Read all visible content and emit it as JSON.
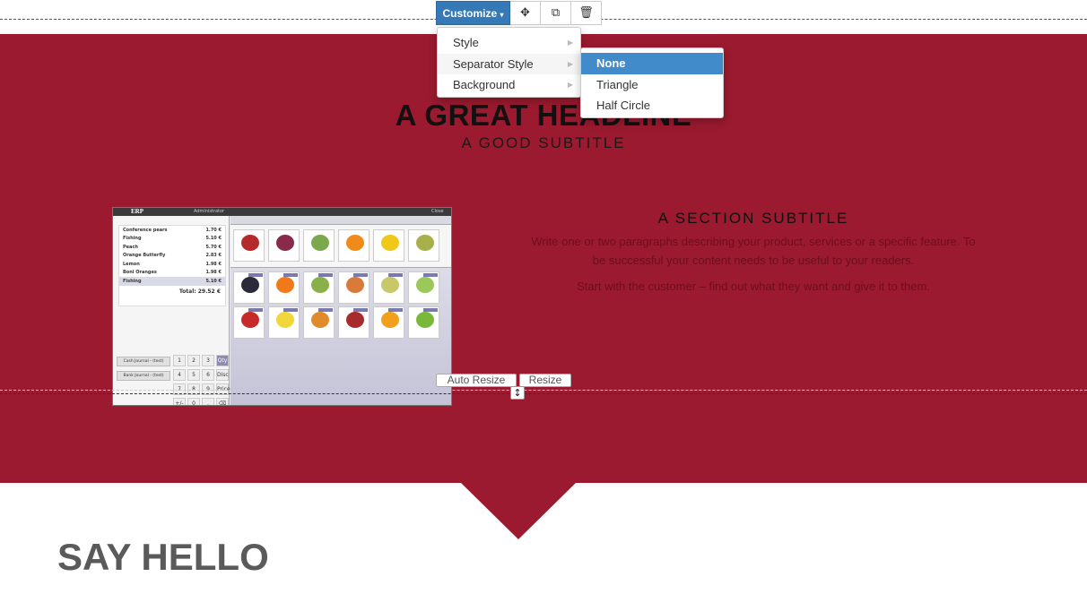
{
  "toolbar": {
    "customize_label": "Customize",
    "move_icon": "move-icon",
    "clone_icon": "clone-icon",
    "delete_icon": "trash-icon"
  },
  "customize_menu": {
    "items": [
      {
        "label": "Style"
      },
      {
        "label": "Separator Style"
      },
      {
        "label": "Background"
      }
    ]
  },
  "separator_submenu": {
    "items": [
      {
        "label": "None",
        "selected": true
      },
      {
        "label": "Triangle"
      },
      {
        "label": "Half Circle"
      }
    ]
  },
  "hero": {
    "headline": "A GREAT HEADLINE",
    "subtitle": "A GOOD SUBTITLE"
  },
  "feature": {
    "section_subtitle": "A SECTION SUBTITLE",
    "paragraph1": "Write one or two paragraphs describing your product, services or a specific feature. To be successful your content needs to be useful to your readers.",
    "paragraph2": "Start with the customer – find out what they want and give it to them."
  },
  "resize": {
    "auto_label": "Auto Resize",
    "resize_label": "Resize"
  },
  "pos": {
    "logo": "ERP",
    "user": "Administrator",
    "close": "Close",
    "orderlines": [
      {
        "name": "Conference pears",
        "price": "1.70 €"
      },
      {
        "name": "Fishing",
        "price": "5.10 €"
      },
      {
        "name": "Peach",
        "price": "5.70 €"
      },
      {
        "name": "Orange Butterfly",
        "price": "2.83 €"
      },
      {
        "name": "Lemon",
        "price": "1.98 €"
      },
      {
        "name": "Boni Oranges",
        "price": "1.98 €"
      },
      {
        "name": "Fishing",
        "price": "5.10 €"
      }
    ],
    "total": "Total: 29.52 €",
    "cash_journal": "Cash Journal - (test)",
    "bank_journal": "Bank Journal - (test)",
    "keys": [
      "1",
      "2",
      "3",
      "Qty",
      "4",
      "5",
      "6",
      "Disc",
      "7",
      "8",
      "9",
      "Price",
      "+/-",
      "0",
      ".",
      "⌫"
    ]
  },
  "footer": {
    "say_hello": "SAY HELLO"
  },
  "colors": {
    "section_bg": "#9b1a2f",
    "accent": "#357ab7",
    "menu_active": "#428bca"
  }
}
